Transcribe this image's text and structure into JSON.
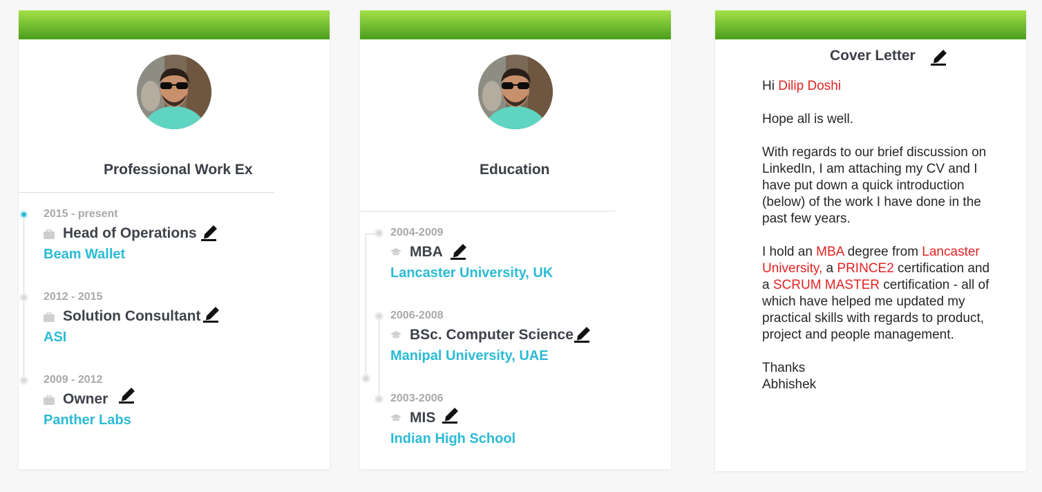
{
  "work": {
    "title": "Professional Work Ex",
    "entries": [
      {
        "date": "2015 - present",
        "role": "Head of Operations",
        "org": "Beam Wallet",
        "icon": "briefcase-icon",
        "active": true
      },
      {
        "date": "2012 - 2015",
        "role": "Solution Consultant",
        "org": "ASI",
        "icon": "briefcase-icon",
        "active": false
      },
      {
        "date": "2009 - 2012",
        "role": "Owner",
        "org": "Panther Labs",
        "icon": "briefcase-icon",
        "active": false
      }
    ]
  },
  "education": {
    "title": "Education",
    "entries": [
      {
        "date": "2004-2009",
        "role": "MBA",
        "org": "Lancaster University, UK",
        "icon": "graduation-cap-icon"
      },
      {
        "date": "2006-2008",
        "role": "BSc. Computer Science",
        "org": "Manipal University, UAE",
        "icon": "graduation-cap-icon"
      },
      {
        "date": "2003-2006",
        "role": "MIS",
        "org": "Indian High School",
        "icon": "graduation-cap-icon"
      }
    ]
  },
  "cover": {
    "title": "Cover Letter",
    "greeting": "Hi ",
    "recipient": "Dilip Doshi",
    "p1": "Hope all is well.",
    "p2": "With regards to our brief discussion on LinkedIn, I am attaching my CV and I have put down a quick introduction (below) of the work I have done in the past few years.",
    "p3_a": "I hold an ",
    "p3_mba": "MBA",
    "p3_b": " degree from ",
    "p3_lancaster": "Lancaster University,",
    "p3_c": " a ",
    "p3_prince2": "PRINCE2",
    "p3_d": " certification and a ",
    "p3_scrum": "SCRUM MASTER",
    "p3_e": " certification - all of which have helped me updated my practical skills with regards to product, project and people management.",
    "signoff": "Thanks",
    "signature": "Abhishek"
  },
  "colors": {
    "header_green_top": "#a4e04a",
    "header_green_bottom": "#4a9e1c",
    "accent_cyan": "#2bbbd6",
    "highlight_red": "#e32222"
  }
}
